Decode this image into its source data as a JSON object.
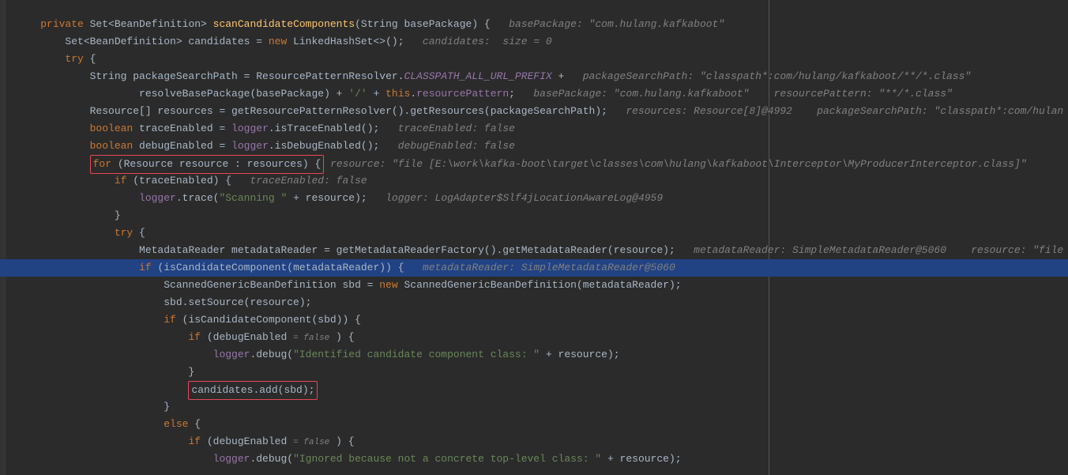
{
  "code": {
    "line1": {
      "pre": "    ",
      "kw_private": "private",
      "type": " Set<BeanDefinition> ",
      "method": "scanCandidateComponents",
      "args": "(String basePackage) {",
      "hint": "   basePackage: \"com.hulang.kafkaboot\""
    },
    "line2": {
      "pre": "        Set<BeanDefinition> candidates = ",
      "kw_new": "new",
      "rest": " LinkedHashSet<>();",
      "hint": "   candidates:  size = 0"
    },
    "line3": {
      "pre": "        ",
      "kw_try": "try",
      "rest": " {"
    },
    "line4": {
      "pre": "            String packageSearchPath = ResourcePatternResolver.",
      "const": "CLASSPATH_ALL_URL_PREFIX",
      "rest": " +",
      "hint": "   packageSearchPath: \"classpath*:com/hulang/kafkaboot/**/*.class\""
    },
    "line5": {
      "pre": "                    resolveBasePackage(basePackage) + ",
      "str1": "'/'",
      "mid": " + ",
      "kw_this": "this",
      "rest": ".",
      "fld": "resourcePattern",
      "semi": ";",
      "hint": "   basePackage: \"com.hulang.kafkaboot\"    resourcePattern: \"**/*.class\""
    },
    "line6": {
      "pre": "            Resource[] resources = getResourcePatternResolver().getResources(packageSearchPath);",
      "hint": "   resources: Resource[8]@4992    packageSearchPath: \"classpath*:com/hulan"
    },
    "line7": {
      "pre": "            ",
      "kw": "boolean",
      "mid": " traceEnabled = ",
      "fld": "logger",
      "rest": ".isTraceEnabled();",
      "hint": "   traceEnabled: false"
    },
    "line8": {
      "pre": "            ",
      "kw": "boolean",
      "mid": " debugEnabled = ",
      "fld": "logger",
      "rest": ".isDebugEnabled();",
      "hint": "   debugEnabled: false"
    },
    "line9": {
      "pre": "            ",
      "box_for": "for",
      "box_rest": " (Resource resource : resources) {",
      "hint": " resource: \"file [E:\\work\\kafka-boot\\target\\classes\\com\\hulang\\kafkaboot\\Interceptor\\MyProducerInterceptor.class]\"   "
    },
    "line10": {
      "pre": "                ",
      "kw_if": "if",
      "rest": " (traceEnabled) {",
      "hint": "   traceEnabled: false"
    },
    "line11": {
      "pre": "                    ",
      "fld": "logger",
      "mid": ".trace(",
      "str": "\"Scanning \"",
      "rest": " + resource);",
      "hint": "   logger: LogAdapter$Slf4jLocationAwareLog@4959"
    },
    "line12": {
      "pre": "                }",
      "rest": ""
    },
    "line13": {
      "pre": "                ",
      "kw_try": "try",
      "rest": " {"
    },
    "line14": {
      "pre": "                    MetadataReader metadataReader = getMetadataReaderFactory().getMetadataReader(resource);",
      "hint": "   metadataReader: SimpleMetadataReader@5060    resource: \"file"
    },
    "line15": {
      "pre": "                    ",
      "kw_if": "if",
      "rest": " (isCandidateComponent(metadataReader)) {",
      "hint": "   metadataReader: SimpleMetadataReader@5060"
    },
    "line16": {
      "pre": "                        ScannedGenericBeanDefinition sbd = ",
      "kw_new": "new",
      "rest": " ScannedGenericBeanDefinition(metadataReader);"
    },
    "line17": {
      "pre": "                        sbd.setSource(resource);"
    },
    "line18": {
      "pre": "                        ",
      "kw_if": "if",
      "rest": " (isCandidateComponent(sbd)) {"
    },
    "line19": {
      "pre": "                            ",
      "kw_if": "if",
      "rest1": " (debugEnabled ",
      "inl": "= false",
      "rest2": " ) {"
    },
    "line20": {
      "pre": "                                ",
      "fld": "logger",
      "mid": ".debug(",
      "str": "\"Identified candidate component class: \"",
      "rest": " + resource);"
    },
    "line21": {
      "pre": "                            }"
    },
    "line22": {
      "pre": "                            ",
      "box": "candidates.add(sbd);"
    },
    "line23": {
      "pre": "                        }"
    },
    "line24": {
      "pre": "                        ",
      "kw_else": "else",
      "rest": " {"
    },
    "line25": {
      "pre": "                            ",
      "kw_if": "if",
      "rest1": " (debugEnabled ",
      "inl": "= false",
      "rest2": " ) {"
    },
    "line26": {
      "pre": "                                ",
      "fld": "logger",
      "mid": ".debug(",
      "str": "\"Ignored because not a concrete top-level class: \"",
      "rest": " + resource);"
    }
  }
}
